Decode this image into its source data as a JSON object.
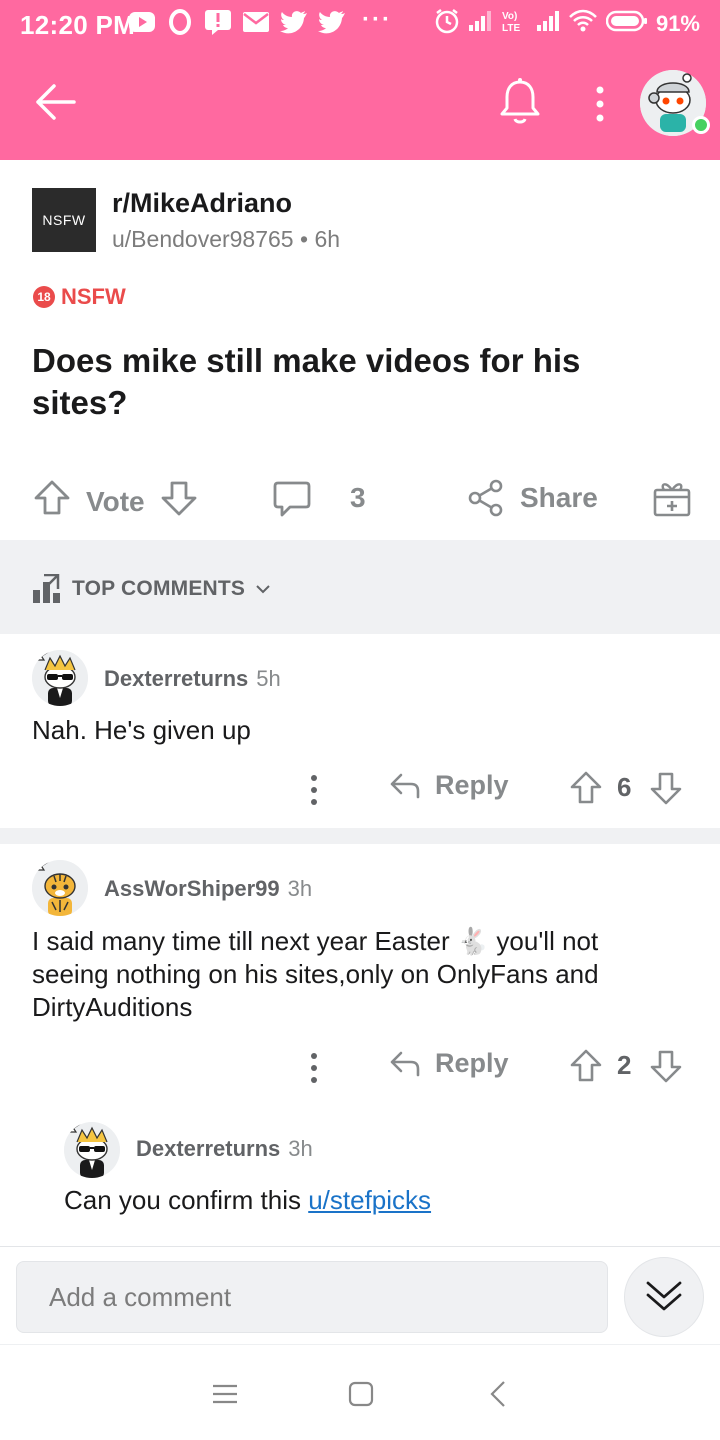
{
  "status_bar": {
    "time": "12:20 PM",
    "dots": "···",
    "battery_percent": "91%",
    "left_icons": [
      "youtube-icon",
      "opera-icon",
      "notification-alert-icon",
      "mail-icon",
      "twitter-icon",
      "twitter-icon"
    ],
    "right_icons": [
      "alarm-icon",
      "signal-icon",
      "volte-icon",
      "signal-icon",
      "wifi-icon",
      "battery-icon"
    ]
  },
  "header": {
    "background_color": "#ff69a0",
    "icons": [
      "back-arrow-icon",
      "bell-icon",
      "more-vertical-icon",
      "user-avatar"
    ]
  },
  "post": {
    "thumbnail_label": "NSFW",
    "subreddit": "r/MikeAdriano",
    "author": "u/Bendover98765",
    "separator": "•",
    "age": "6h",
    "nsfw_badge_number": "18",
    "nsfw_label": "NSFW",
    "title": "Does mike still make videos for his sites?",
    "actions": {
      "vote_label": "Vote",
      "comment_count": "3",
      "share_label": "Share"
    }
  },
  "comments_header": {
    "sort_label": "TOP COMMENTS"
  },
  "comments": [
    {
      "author": "Dexterreturns",
      "age": "5h",
      "body": "Nah. He's given up",
      "reply_label": "Reply",
      "score": "6"
    },
    {
      "author": "AssWorShiper99",
      "age": "3h",
      "body": "I said many time till next year Easter 🐇 you'll not seeing nothing on his sites,only on OnlyFans and DirtyAuditions",
      "reply_label": "Reply",
      "score": "2"
    },
    {
      "author": "Dexterreturns",
      "age": "3h",
      "body_prefix": "Can you confirm this ",
      "body_link": "u/stefpicks"
    }
  ],
  "composer": {
    "placeholder": "Add a comment"
  },
  "colors": {
    "accent_pink": "#ff69a0",
    "nsfw_red": "#ea4b4b",
    "link_blue": "#1a73c8",
    "online_green": "#46d160"
  }
}
